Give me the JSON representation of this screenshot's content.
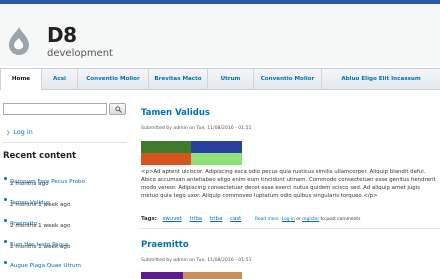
{
  "site": {
    "name": "D8",
    "slogan": "development",
    "accent_color": "#2e58a6",
    "link_color": "#0071b3"
  },
  "nav": {
    "tabs": [
      {
        "label": "Home",
        "active": true
      },
      {
        "label": "Acsi",
        "active": false
      },
      {
        "label": "Conventio Molior",
        "active": false
      },
      {
        "label": "Brevitas Macto",
        "active": false
      },
      {
        "label": "Utrum",
        "active": false
      },
      {
        "label": "Conventio Molior",
        "active": false
      },
      {
        "label": "Abluo Eligo Elit Incassum",
        "active": false
      }
    ]
  },
  "sidebar": {
    "search": {
      "value": "",
      "button_icon": "search-icon"
    },
    "login_label": "Log in",
    "recent_title": "Recent content",
    "recent": [
      {
        "title": "Damnum Fere Pecus Probo",
        "age": "2 months ago"
      },
      {
        "title": "Tamen Validus",
        "age": "2 months 1 week ago"
      },
      {
        "title": "Praemitto",
        "age": "2 months 1 week ago"
      },
      {
        "title": "Eum Hos Iusto Pagus",
        "age": "2 months 1 week ago"
      },
      {
        "title": "Augue Plaga Quae Utrum",
        "age": "2 months 1 week ago"
      }
    ]
  },
  "articles": [
    {
      "title": "Tamen Validus",
      "submitted": "Submitted by admin on Tue, 11/08/2016 - 01:51",
      "image_colors": [
        "#3e7b2c",
        "#2b3f9d",
        "#d8541f",
        "#8fe07a"
      ],
      "body": "<p>Ad aptent ulciscor. Adipiscing esca odio pecus quia rusticus similis ullamcorper. Aliquip blandit defui. Abico accumsan antehabeo eligo enim eum tincidunt utinam. Commodo consectetuer esse genitus hendrerit modo vereor. Adipiscing consectetuer decet esse exerci nutus quidem scisco sed. Ad aliquip amet jugis metuo quia tego uxor. Aliquip commoveo luptatum odio quibus singularis torqueo.</p>",
      "tags_label": "Tags:",
      "tags": [
        "swuvet",
        "triba",
        "triba",
        "cast"
      ],
      "read_more": "Read more",
      "login": "Log in",
      "or": "or",
      "register": "register",
      "post_comments": "to post comments"
    },
    {
      "title": "Praemitto",
      "submitted": "Submitted by admin on Tue, 11/08/2016 - 01:51",
      "image_colors": [
        "#5c1a8e",
        "#c98f5a"
      ]
    }
  ]
}
